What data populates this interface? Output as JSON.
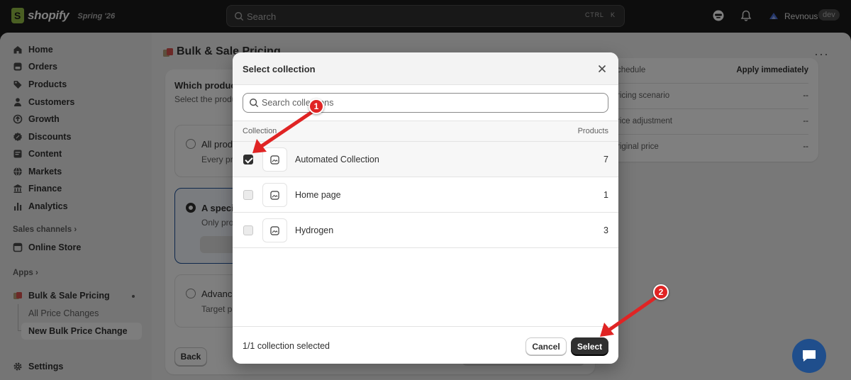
{
  "topbar": {
    "logo_text": "shopify",
    "edition": "Spring '26",
    "search_placeholder": "Search",
    "kbd_ctrl": "CTRL",
    "kbd_k": "K",
    "user_name": "Revnous",
    "user_badge": "dev"
  },
  "sidebar": {
    "items": [
      {
        "label": "Home",
        "icon": "home-icon"
      },
      {
        "label": "Orders",
        "icon": "orders-icon"
      },
      {
        "label": "Products",
        "icon": "tag-icon"
      },
      {
        "label": "Customers",
        "icon": "person-icon"
      },
      {
        "label": "Growth",
        "icon": "growth-icon"
      },
      {
        "label": "Discounts",
        "icon": "discount-icon"
      },
      {
        "label": "Content",
        "icon": "content-icon"
      },
      {
        "label": "Markets",
        "icon": "globe-icon"
      },
      {
        "label": "Finance",
        "icon": "bank-icon"
      },
      {
        "label": "Analytics",
        "icon": "bar-chart-icon"
      }
    ],
    "sales_channels": "Sales channels",
    "online_store": "Online Store",
    "apps": "Apps",
    "app_name": "Bulk & Sale Pricing",
    "app_sub_1": "All Price Changes",
    "app_sub_2": "New Bulk Price Change",
    "settings": "Settings"
  },
  "main": {
    "page_title": "Bulk & Sale Pricing",
    "section_title": "Which produc",
    "section_sub": "Select the produ",
    "opt1_title": "All produ",
    "opt1_desc": "Every pr",
    "opt2_title": "A specif",
    "opt2_desc": "Only pro",
    "opt3_title": "Advance",
    "opt3_desc": "Target p",
    "back": "Back",
    "summary": [
      {
        "label": "chedule",
        "value": "Apply immediately"
      },
      {
        "label": "ricing scenario",
        "value": "--"
      },
      {
        "label": "rice adjustment",
        "value": "--"
      },
      {
        "label": "riginal price",
        "value": "--"
      }
    ]
  },
  "modal": {
    "title": "Select collection",
    "search_placeholder": "Search collections",
    "col_collection": "Collection",
    "col_products": "Products",
    "rows": [
      {
        "name": "Automated Collection",
        "count": "7",
        "checked": true
      },
      {
        "name": "Home page",
        "count": "1",
        "checked": false
      },
      {
        "name": "Hydrogen",
        "count": "3",
        "checked": false
      }
    ],
    "status": "1/1 collection selected",
    "cancel": "Cancel",
    "select": "Select"
  },
  "annotations": {
    "step1": "1",
    "step2": "2",
    "arrow_color": "#e02424"
  },
  "colors": {
    "topbar": "#1a1a1a",
    "primary_button": "#303030",
    "accent_border": "#1f5199"
  }
}
